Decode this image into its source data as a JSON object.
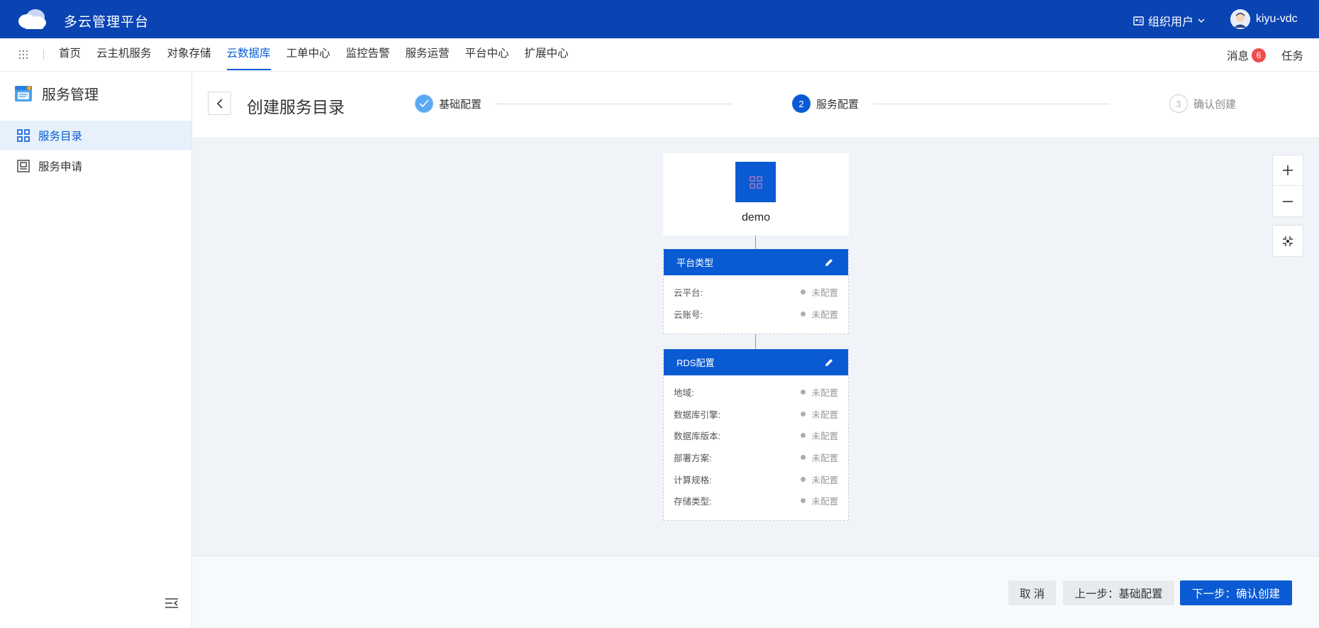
{
  "header": {
    "app_title": "多云管理平台",
    "org_label": "组织用户",
    "username": "kiyu-vdc"
  },
  "nav": {
    "items": [
      {
        "label": "首页"
      },
      {
        "label": "云主机服务"
      },
      {
        "label": "对象存储"
      },
      {
        "label": "云数据库",
        "active": true
      },
      {
        "label": "工单中心"
      },
      {
        "label": "监控告警"
      },
      {
        "label": "服务运营"
      },
      {
        "label": "平台中心"
      },
      {
        "label": "扩展中心"
      }
    ],
    "messages_label": "消息",
    "messages_count": "6",
    "tasks_label": "任务"
  },
  "sidebar": {
    "title": "服务管理",
    "items": [
      {
        "label": "服务目录",
        "active": true
      },
      {
        "label": "服务申请"
      }
    ]
  },
  "page": {
    "title": "创建服务目录",
    "steps": [
      {
        "number": "1",
        "label": "基础配置",
        "status": "done"
      },
      {
        "number": "2",
        "label": "服务配置",
        "status": "current"
      },
      {
        "number": "3",
        "label": "确认创建",
        "status": "pending"
      }
    ]
  },
  "canvas": {
    "root_name": "demo",
    "cards": [
      {
        "title": "平台类型",
        "rows": [
          {
            "label": "云平台:",
            "status": "未配置"
          },
          {
            "label": "云账号:",
            "status": "未配置"
          }
        ]
      },
      {
        "title": "RDS配置",
        "rows": [
          {
            "label": "地域:",
            "status": "未配置"
          },
          {
            "label": "数据库引擎:",
            "status": "未配置"
          },
          {
            "label": "数据库版本:",
            "status": "未配置"
          },
          {
            "label": "部署方案:",
            "status": "未配置"
          },
          {
            "label": "计算规格:",
            "status": "未配置"
          },
          {
            "label": "存储类型:",
            "status": "未配置"
          }
        ]
      }
    ]
  },
  "footer": {
    "cancel_label": "取 消",
    "prev_label": "上一步：基础配置",
    "next_label": "下一步：确认创建"
  },
  "colors": {
    "header_bg": "#0a44b3",
    "primary": "#0a5bd3",
    "badge": "#ef4b4b"
  }
}
